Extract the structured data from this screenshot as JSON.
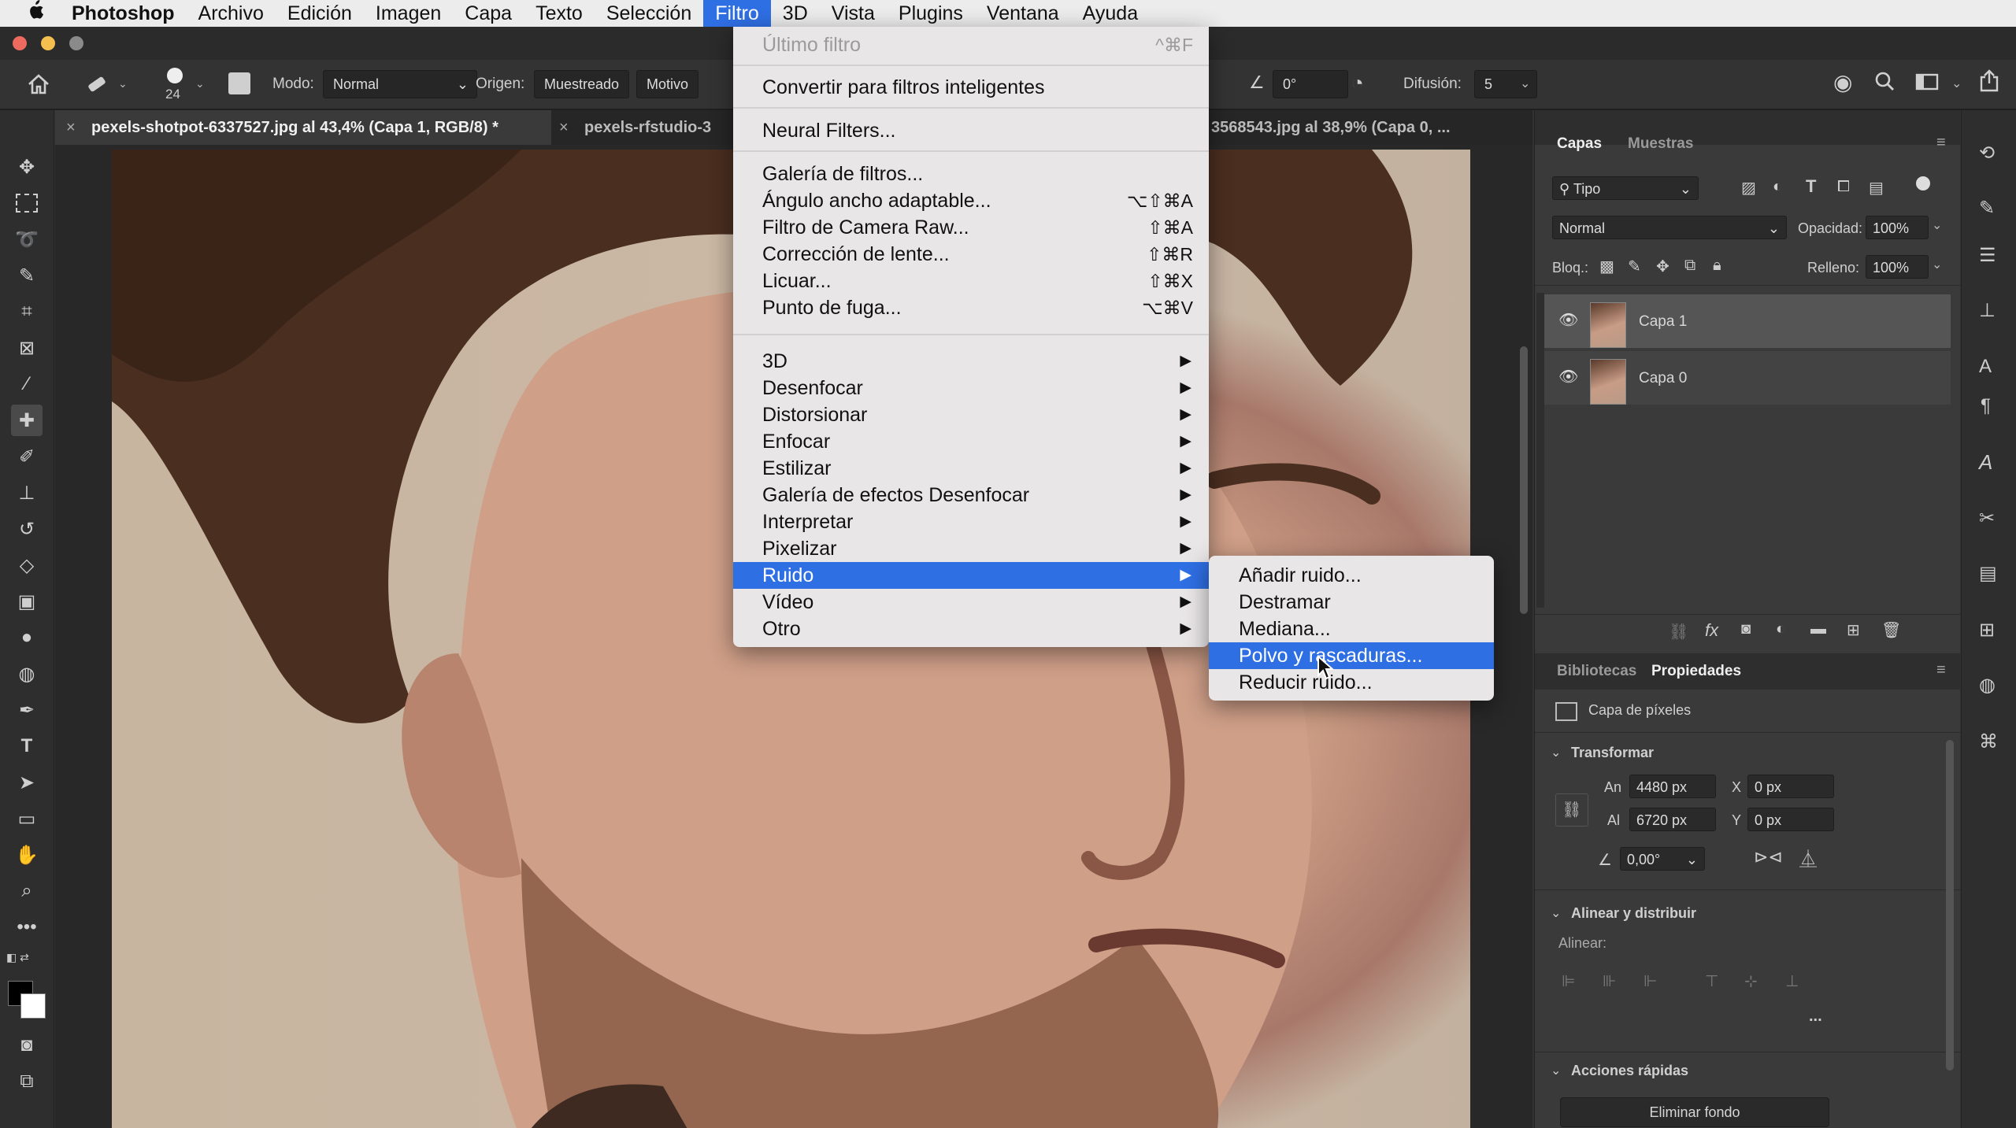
{
  "menubar": {
    "app": "Photoshop",
    "items": [
      "Archivo",
      "Edición",
      "Imagen",
      "Capa",
      "Texto",
      "Selección",
      "Filtro",
      "3D",
      "Vista",
      "Plugins",
      "Ventana",
      "Ayuda"
    ],
    "active": "Filtro"
  },
  "options": {
    "brush_size": "24",
    "mode_label": "Modo:",
    "mode_value": "Normal",
    "source_label": "Origen:",
    "source_sampled": "Muestreado",
    "source_pattern": "Motivo",
    "angle_value": "0°",
    "diffusion_label": "Difusión:",
    "diffusion_value": "5"
  },
  "tabs": [
    {
      "label": "pexels-shotpot-6337527.jpg al 43,4% (Capa 1, RGB/8) *",
      "active": true
    },
    {
      "label": "pexels-rfstudio-3",
      "active": false
    },
    {
      "label": "3568543.jpg al 38,9% (Capa 0, ...",
      "active": false
    }
  ],
  "filter_menu": {
    "items": [
      {
        "label": "Último filtro",
        "shortcut": "^⌘F",
        "disabled": true
      },
      {
        "sep": true
      },
      {
        "label": "Convertir para filtros inteligentes"
      },
      {
        "sep": true
      },
      {
        "label": "Neural Filters..."
      },
      {
        "sep": true
      },
      {
        "label": "Galería de filtros..."
      },
      {
        "label": "Ángulo ancho adaptable...",
        "shortcut": "⌥⇧⌘A"
      },
      {
        "label": "Filtro de Camera Raw...",
        "shortcut": "⇧⌘A"
      },
      {
        "label": "Corrección de lente...",
        "shortcut": "⇧⌘R"
      },
      {
        "label": "Licuar...",
        "shortcut": "⇧⌘X"
      },
      {
        "label": "Punto de fuga...",
        "shortcut": "⌥⌘V"
      },
      {
        "sep": true
      },
      {
        "label": "3D",
        "submenu": true
      },
      {
        "label": "Desenfocar",
        "submenu": true
      },
      {
        "label": "Distorsionar",
        "submenu": true
      },
      {
        "label": "Enfocar",
        "submenu": true
      },
      {
        "label": "Estilizar",
        "submenu": true
      },
      {
        "label": "Galería de efectos Desenfocar",
        "submenu": true
      },
      {
        "label": "Interpretar",
        "submenu": true
      },
      {
        "label": "Pixelizar",
        "submenu": true
      },
      {
        "label": "Ruido",
        "submenu": true,
        "highlighted": true
      },
      {
        "label": "Vídeo",
        "submenu": true
      },
      {
        "label": "Otro",
        "submenu": true
      }
    ]
  },
  "noise_submenu": {
    "items": [
      {
        "label": "Añadir ruido..."
      },
      {
        "label": "Destramar"
      },
      {
        "label": "Mediana..."
      },
      {
        "label": "Polvo y rascaduras...",
        "highlighted": true
      },
      {
        "label": "Reducir ruido..."
      }
    ]
  },
  "layers_panel": {
    "tabs": [
      "Capas",
      "Muestras"
    ],
    "filter_label": "Tipo",
    "blend_mode": "Normal",
    "opacity_label": "Opacidad:",
    "opacity_value": "100%",
    "lock_label": "Bloq.:",
    "fill_label": "Relleno:",
    "fill_value": "100%",
    "layers": [
      {
        "name": "Capa 1",
        "selected": true
      },
      {
        "name": "Capa 0",
        "selected": false
      }
    ]
  },
  "properties_panel": {
    "tabs": [
      "Bibliotecas",
      "Propiedades"
    ],
    "kind": "Capa de píxeles",
    "transform_title": "Transformar",
    "w_label": "An",
    "w_value": "4480 px",
    "h_label": "Al",
    "h_value": "6720 px",
    "x_label": "X",
    "x_value": "0 px",
    "y_label": "Y",
    "y_value": "0 px",
    "angle_value": "0,00°",
    "align_title": "Alinear y distribuir",
    "align_label": "Alinear:",
    "more": "...",
    "quick_title": "Acciones rápidas",
    "remove_bg": "Eliminar fondo"
  },
  "colors": {
    "accent": "#2f6fe4",
    "foreground": "#000000",
    "background": "#ffffff"
  }
}
